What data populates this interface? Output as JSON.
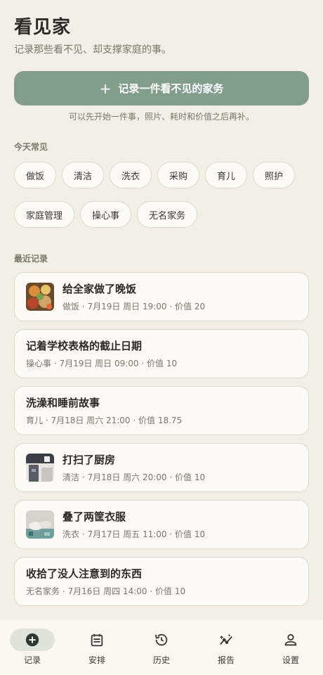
{
  "header": {
    "title": "看见家",
    "subtitle": "记录那些看不见、却支撑家庭的事。"
  },
  "cta": {
    "label": "记录一件看不见的家务",
    "hint": "可以先开始一件事，照片、耗时和价值之后再补。"
  },
  "common": {
    "label": "今天常见",
    "chips": [
      "做饭",
      "清洁",
      "洗衣",
      "采购",
      "育儿",
      "照护",
      "家庭管理",
      "操心事",
      "无名家务"
    ]
  },
  "recent": {
    "label": "最近记录",
    "items": [
      {
        "title": "给全家做了晚饭",
        "meta": "做饭 · 7月19日 周日 19:00 · 价值 20",
        "thumb": "food"
      },
      {
        "title": "记着学校表格的截止日期",
        "meta": "操心事 · 7月19日 周日 09:00 · 价值 10",
        "thumb": ""
      },
      {
        "title": "洗澡和睡前故事",
        "meta": "育儿 · 7月18日 周六 21:00 · 价值 18.75",
        "thumb": ""
      },
      {
        "title": "打扫了厨房",
        "meta": "清洁 · 7月18日 周六 20:00 · 价值 10",
        "thumb": "kitchen"
      },
      {
        "title": "叠了两筐衣服",
        "meta": "洗衣 · 7月17日 周五 11:00 · 价值 10",
        "thumb": "laundry"
      },
      {
        "title": "收拾了没人注意到的东西",
        "meta": "无名家务 · 7月16日 周四 14:00 · 价值 10",
        "thumb": ""
      }
    ]
  },
  "nav": {
    "items": [
      {
        "label": "记录",
        "icon": "add-circle-icon"
      },
      {
        "label": "安排",
        "icon": "calendar-icon"
      },
      {
        "label": "历史",
        "icon": "history-icon"
      },
      {
        "label": "报告",
        "icon": "insights-icon"
      },
      {
        "label": "设置",
        "icon": "person-icon"
      }
    ]
  },
  "colors": {
    "background": "#f3efe6",
    "accent": "#839d8b",
    "card": "#fdfbf6",
    "active_nav": "#dfe3da"
  }
}
